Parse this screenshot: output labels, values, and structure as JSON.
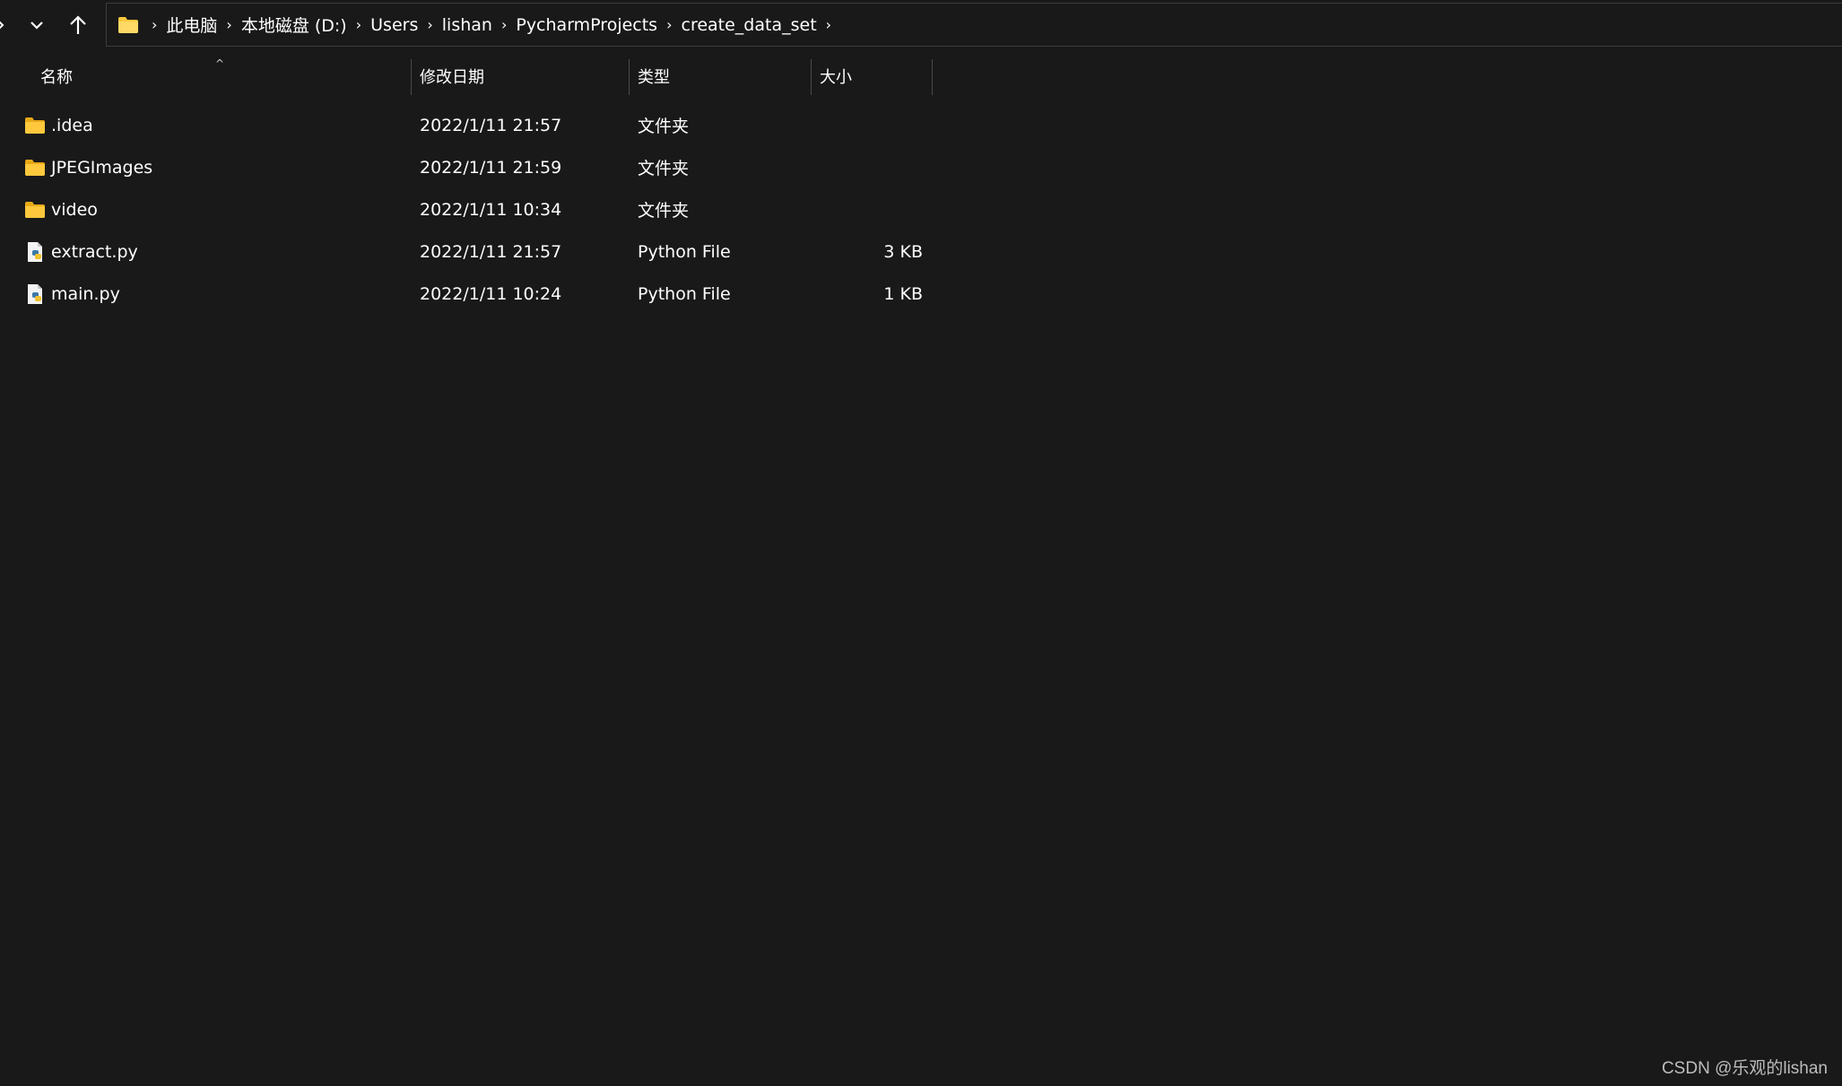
{
  "nav": {
    "back_icon": "chevron-right-icon",
    "recent_icon": "chevron-down-icon",
    "up_icon": "arrow-up-icon"
  },
  "address_bar": {
    "root_icon": "folder-icon",
    "crumbs": [
      "此电脑",
      "本地磁盘 (D:)",
      "Users",
      "lishan",
      "PycharmProjects",
      "create_data_set"
    ]
  },
  "columns": {
    "name": "名称",
    "date": "修改日期",
    "type": "类型",
    "size": "大小",
    "sort_indicator": "^"
  },
  "files": [
    {
      "name": ".idea",
      "date": "2022/1/11 21:57",
      "type": "文件夹",
      "size": "",
      "icon": "folder-icon"
    },
    {
      "name": "JPEGImages",
      "date": "2022/1/11 21:59",
      "type": "文件夹",
      "size": "",
      "icon": "folder-icon"
    },
    {
      "name": "video",
      "date": "2022/1/11 10:34",
      "type": "文件夹",
      "size": "",
      "icon": "folder-icon"
    },
    {
      "name": "extract.py",
      "date": "2022/1/11 21:57",
      "type": "Python File",
      "size": "3 KB",
      "icon": "python-file-icon"
    },
    {
      "name": "main.py",
      "date": "2022/1/11 10:24",
      "type": "Python File",
      "size": "1 KB",
      "icon": "python-file-icon"
    }
  ],
  "watermark": "CSDN @乐观的lishan",
  "colors": {
    "background": "#191919",
    "text": "#ffffff",
    "folder": "#ffc83d",
    "divider": "#4a4a4a"
  }
}
